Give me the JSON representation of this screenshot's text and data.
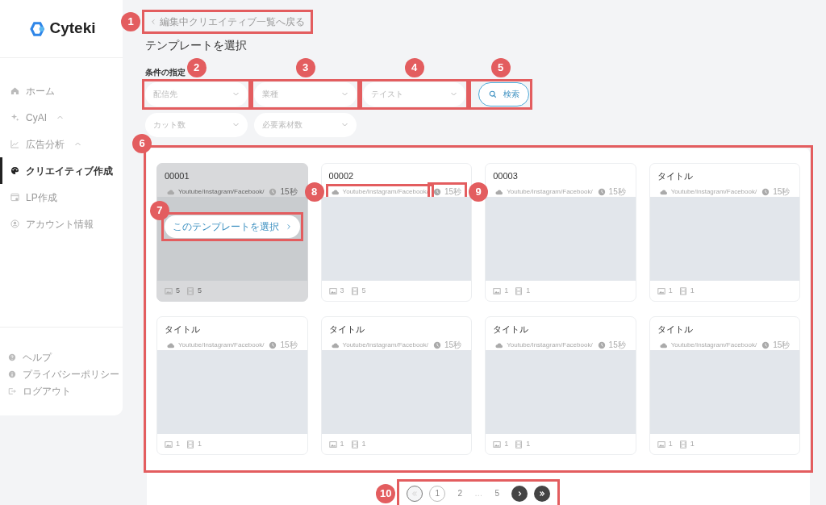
{
  "sidebar": {
    "logo": "Cyteki",
    "nav": [
      {
        "label": "ホーム",
        "kind": "home",
        "selected": false
      },
      {
        "label": "CyAI",
        "kind": "sparkle",
        "selected": false,
        "expanded": true
      },
      {
        "label": "広告分析",
        "kind": "chart",
        "selected": false,
        "expanded": true
      },
      {
        "label": "クリエイティブ作成",
        "kind": "palette",
        "selected": true
      },
      {
        "label": "LP作成",
        "kind": "browser",
        "selected": false
      },
      {
        "label": "アカウント情報",
        "kind": "user",
        "selected": false
      }
    ],
    "footer_links": [
      {
        "label": "ヘルプ",
        "kind": "help"
      },
      {
        "label": "プライバシーポリシー",
        "kind": "info"
      },
      {
        "label": "ログアウト",
        "kind": "logout"
      }
    ]
  },
  "back_link": {
    "label": "編集中クリエイティブ一覧へ戻る",
    "callout": "1"
  },
  "title": "テンプレートを選択",
  "filters": {
    "label": "条件の指定",
    "rows": [
      {
        "selects": [
          {
            "placeholder": "配信先",
            "callout": "2"
          },
          {
            "placeholder": "業種",
            "callout": "3"
          },
          {
            "placeholder": "テイスト",
            "callout": "4"
          }
        ],
        "search_button": {
          "label": "検索",
          "callout": "5"
        }
      },
      {
        "selects": [
          {
            "placeholder": "カット数"
          },
          {
            "placeholder": "必要素材数"
          }
        ]
      }
    ]
  },
  "grid": {
    "callout": "6",
    "cards": [
      {
        "title": "00001",
        "platforms": "Youtube/Instagram/Facebook/",
        "duration": "15秒",
        "images": "5",
        "cuts": "5",
        "hovered": true,
        "select_button": {
          "label": "このテンプレートを選択",
          "callout": "7"
        }
      },
      {
        "title": "00002",
        "platforms": "Youtube/Instagram/Facebook/",
        "duration": "15秒",
        "images": "3",
        "cuts": "5",
        "hovered": false,
        "platforms_callout": "8",
        "duration_callout": "9"
      },
      {
        "title": "00003",
        "platforms": "Youtube/Instagram/Facebook/",
        "duration": "15秒",
        "images": "1",
        "cuts": "1",
        "hovered": false
      },
      {
        "title": "タイトル",
        "platforms": "Youtube/Instagram/Facebook/",
        "duration": "15秒",
        "images": "1",
        "cuts": "1",
        "hovered": false
      },
      {
        "title": "タイトル",
        "platforms": "Youtube/Instagram/Facebook/",
        "duration": "15秒",
        "images": "1",
        "cuts": "1",
        "hovered": false
      },
      {
        "title": "タイトル",
        "platforms": "Youtube/Instagram/Facebook/",
        "duration": "15秒",
        "images": "1",
        "cuts": "1",
        "hovered": false
      },
      {
        "title": "タイトル",
        "platforms": "Youtube/Instagram/Facebook/",
        "duration": "15秒",
        "images": "1",
        "cuts": "1",
        "hovered": false
      },
      {
        "title": "タイトル",
        "platforms": "Youtube/Instagram/Facebook/",
        "duration": "15秒",
        "images": "1",
        "cuts": "1",
        "hovered": false
      }
    ]
  },
  "pagination": {
    "callout": "10",
    "items": [
      {
        "kind": "first",
        "disabled": true
      },
      {
        "kind": "page",
        "label": "1",
        "selected": true
      },
      {
        "kind": "page",
        "label": "2",
        "selected": false
      },
      {
        "kind": "ellipsis",
        "label": "…"
      },
      {
        "kind": "page",
        "label": "5",
        "selected": false
      },
      {
        "kind": "next",
        "disabled": false
      },
      {
        "kind": "last",
        "disabled": false
      }
    ]
  }
}
